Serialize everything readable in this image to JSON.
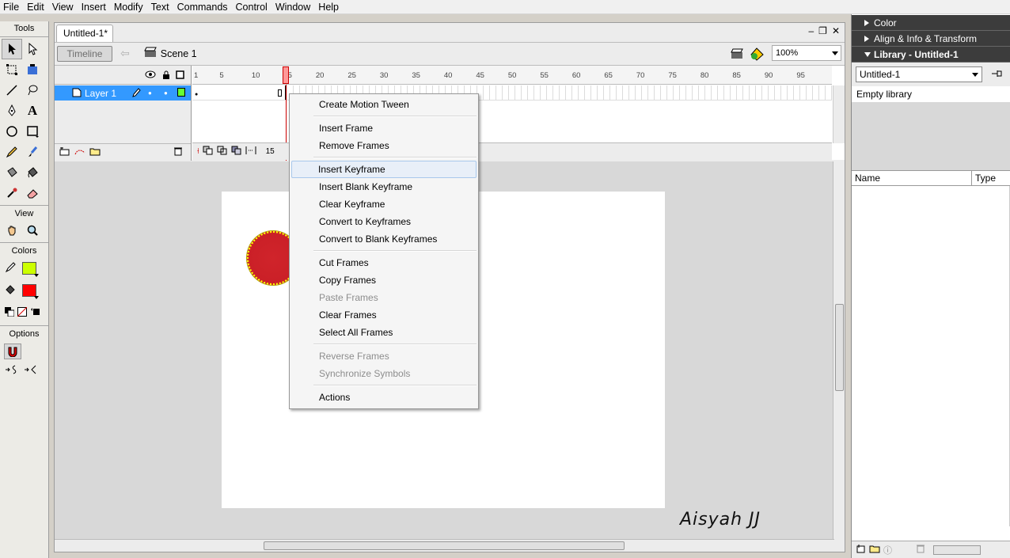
{
  "menu": [
    "File",
    "Edit",
    "View",
    "Insert",
    "Modify",
    "Text",
    "Commands",
    "Control",
    "Window",
    "Help"
  ],
  "tools": {
    "title": "Tools",
    "view_label": "View",
    "colors_label": "Colors",
    "options_label": "Options",
    "stroke_color": "#ccff00",
    "fill_color": "#ff0000"
  },
  "document": {
    "tab_title": "Untitled-1*",
    "timeline_button": "Timeline",
    "scene_label": "Scene 1",
    "zoom": "100%"
  },
  "timeline": {
    "layer_name": "Layer 1",
    "ruler_ticks": [
      "1",
      "5",
      "10",
      "15",
      "20",
      "25",
      "30",
      "35",
      "40",
      "45",
      "50",
      "55",
      "60",
      "65",
      "70",
      "75",
      "80",
      "85",
      "90",
      "95"
    ],
    "current_frame": "15"
  },
  "stage": {
    "signature": "Aisyah JJ",
    "circle_fill": "#c81e25",
    "circle_stroke": "#ffff00"
  },
  "context_menu": {
    "groups": [
      [
        {
          "label": "Create Motion Tween",
          "enabled": true
        }
      ],
      [
        {
          "label": "Insert Frame",
          "enabled": true
        },
        {
          "label": "Remove Frames",
          "enabled": true
        }
      ],
      [
        {
          "label": "Insert Keyframe",
          "enabled": true,
          "hover": true
        },
        {
          "label": "Insert Blank Keyframe",
          "enabled": true
        },
        {
          "label": "Clear Keyframe",
          "enabled": true
        },
        {
          "label": "Convert to Keyframes",
          "enabled": true
        },
        {
          "label": "Convert to Blank Keyframes",
          "enabled": true
        }
      ],
      [
        {
          "label": "Cut Frames",
          "enabled": true
        },
        {
          "label": "Copy Frames",
          "enabled": true
        },
        {
          "label": "Paste Frames",
          "enabled": false
        },
        {
          "label": "Clear Frames",
          "enabled": true
        },
        {
          "label": "Select All Frames",
          "enabled": true
        }
      ],
      [
        {
          "label": "Reverse Frames",
          "enabled": false
        },
        {
          "label": "Synchronize Symbols",
          "enabled": false
        }
      ],
      [
        {
          "label": "Actions",
          "enabled": true
        }
      ]
    ]
  },
  "panels": {
    "color": "Color",
    "align": "Align & Info & Transform",
    "library": "Library - Untitled-1",
    "library_select": "Untitled-1",
    "library_status": "Empty library",
    "col_name": "Name",
    "col_type": "Type"
  }
}
